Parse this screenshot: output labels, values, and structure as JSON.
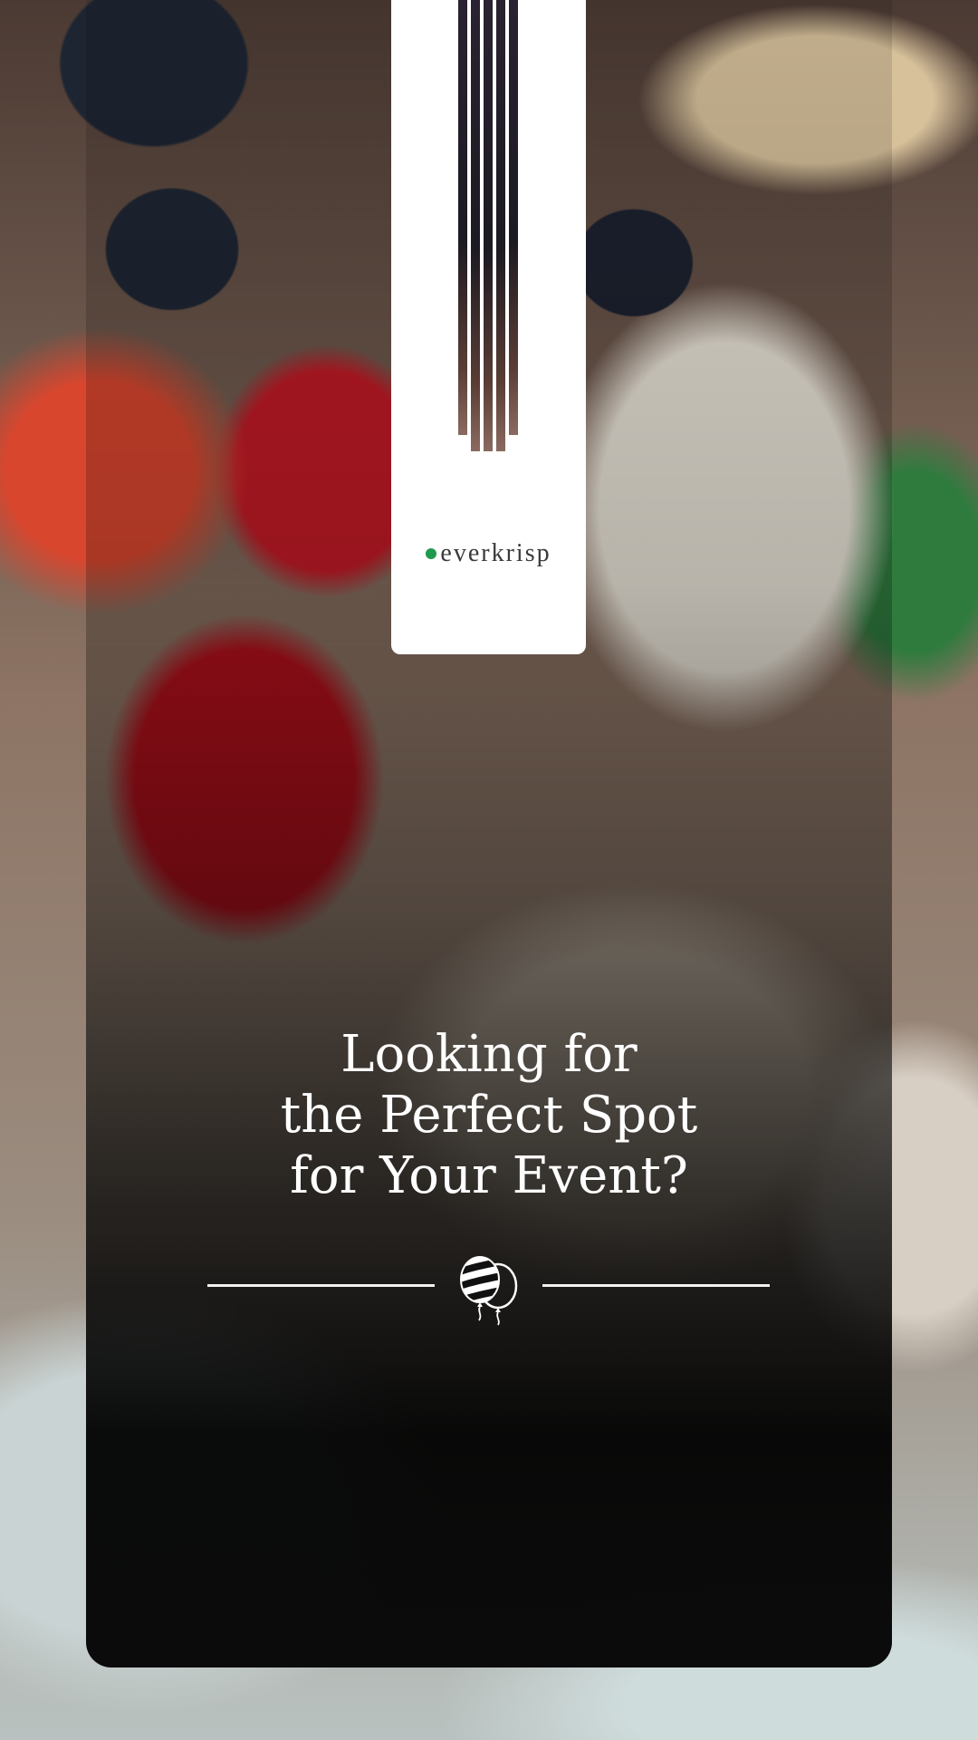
{
  "brand": {
    "name": "everkrisp",
    "dot_color": "#1f9a4c"
  },
  "headline": {
    "line1": "Looking for",
    "line2": "the Perfect Spot",
    "line3": "for Your Event?"
  },
  "icons": {
    "divider_icon": "balloons-icon"
  },
  "colors": {
    "text": "#ffffff",
    "card": "#0b0b0b",
    "logo_background": "#ffffff"
  }
}
